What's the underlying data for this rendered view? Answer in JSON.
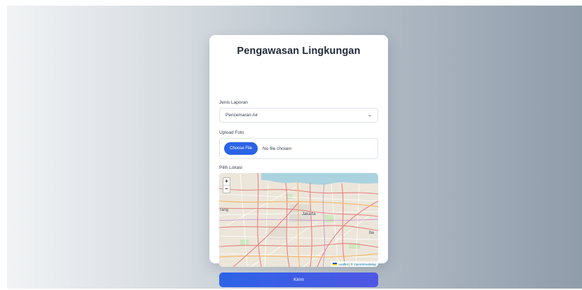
{
  "form": {
    "title": "Pengawasan Lingkungan",
    "report_type": {
      "label": "Jenis Laporan",
      "selected": "Pencemaran Air"
    },
    "photo": {
      "label": "Upload Foto",
      "button_label": "Choose File",
      "status": "No file chosen"
    },
    "location": {
      "label": "Pilih Lokasi"
    },
    "submit_label": "Kirim"
  },
  "map": {
    "zoom_in": "+",
    "zoom_out": "−",
    "places": {
      "jakarta": "Jakarta",
      "tangerang_partial": "rang",
      "bekasi_partial": "Be"
    },
    "attribution": {
      "leaflet": "Leaflet",
      "separator": " | © ",
      "osm": "OpenStreetMap"
    }
  },
  "colors": {
    "primary": "#2b63e6",
    "submit_gradient_end": "#4f57e4",
    "title_text": "#1f2937"
  }
}
